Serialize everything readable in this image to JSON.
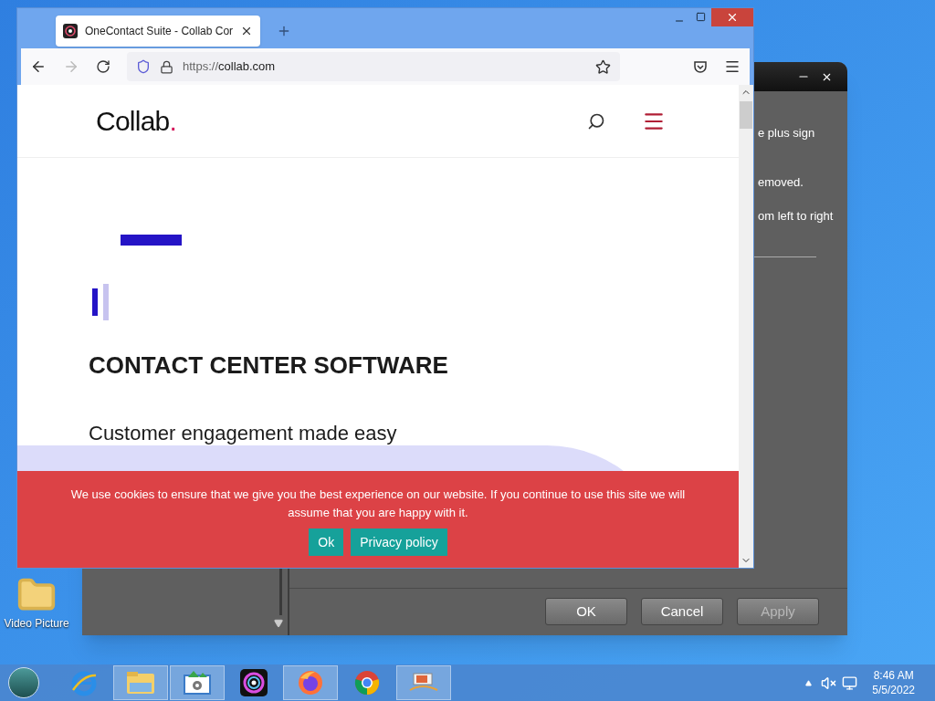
{
  "desktop_icons": [
    {
      "label": "Video Picture"
    }
  ],
  "dialog": {
    "lines": [
      "e plus sign",
      "emoved.",
      "om left to right"
    ],
    "buttons": [
      {
        "label": "OK",
        "disabled": false
      },
      {
        "label": "Cancel",
        "disabled": false
      },
      {
        "label": "Apply",
        "disabled": true
      }
    ]
  },
  "browser": {
    "tabs": [
      {
        "title": "OneContact Suite - Collab Cor",
        "selected": true
      }
    ],
    "url": {
      "scheme": "https://",
      "host": "collab.com"
    },
    "page": {
      "logo": {
        "text": "Collab",
        "dot": "."
      },
      "heading": "CONTACT CENTER SOFTWARE",
      "subheading": "Customer engagement made easy"
    },
    "cookie_banner": {
      "message": "We use cookies to ensure that we give you the best experience on our website. If you continue to use this site we will assume that you are happy with it.",
      "buttons": [
        "Ok",
        "Privacy policy"
      ]
    }
  },
  "taskbar": {
    "items": [
      {
        "kind": "ie",
        "running": false
      },
      {
        "kind": "explorer",
        "running": true
      },
      {
        "kind": "control",
        "running": true
      },
      {
        "kind": "camera",
        "running": false
      },
      {
        "kind": "firefox",
        "running": true
      },
      {
        "kind": "chrome",
        "running": false
      },
      {
        "kind": "network",
        "running": true
      }
    ],
    "clock": {
      "time": "8:46 AM",
      "date": "5/5/2022"
    }
  }
}
